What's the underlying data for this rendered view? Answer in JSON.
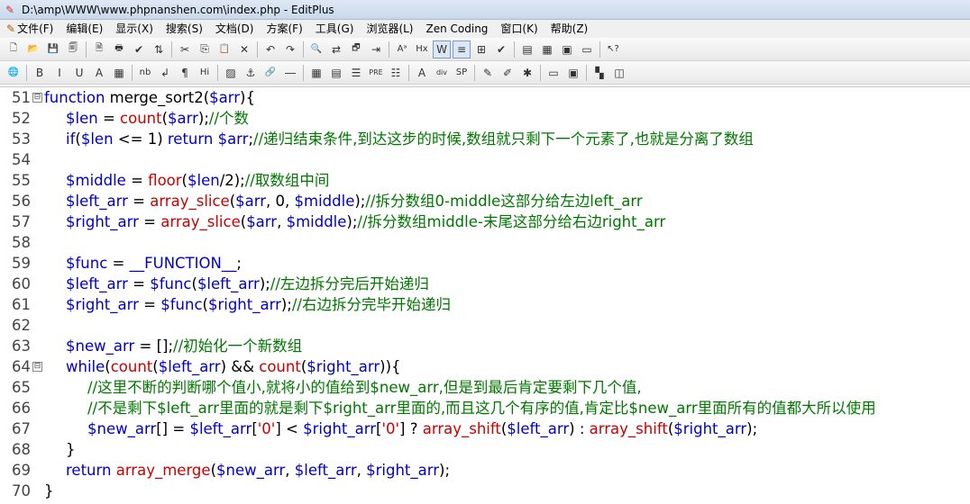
{
  "window": {
    "title": "D:\\amp\\WWW\\www.phpnanshen.com\\index.php - EditPlus"
  },
  "menu": [
    {
      "label": "文件(F)"
    },
    {
      "label": "编辑(E)"
    },
    {
      "label": "显示(X)"
    },
    {
      "label": "搜索(S)"
    },
    {
      "label": "文档(D)"
    },
    {
      "label": "方案(F)"
    },
    {
      "label": "工具(G)"
    },
    {
      "label": "浏览器(L)"
    },
    {
      "label": "Zen Coding"
    },
    {
      "label": "窗口(K)"
    },
    {
      "label": "帮助(Z)"
    }
  ],
  "toolbar1": [
    {
      "name": "new-file-icon",
      "glyph": "🗋"
    },
    {
      "name": "open-file-icon",
      "glyph": "📂"
    },
    {
      "name": "save-icon",
      "glyph": "💾"
    },
    {
      "name": "save-all-icon",
      "glyph": "🗐"
    },
    {
      "sep": true
    },
    {
      "name": "print-preview-icon",
      "glyph": "🗎"
    },
    {
      "name": "print-icon",
      "glyph": "🖶"
    },
    {
      "name": "spell-check-icon",
      "glyph": "✔"
    },
    {
      "name": "ftp-icon",
      "glyph": "⇅"
    },
    {
      "sep": true
    },
    {
      "name": "cut-icon",
      "glyph": "✂"
    },
    {
      "name": "copy-icon",
      "glyph": "⎘"
    },
    {
      "name": "paste-icon",
      "glyph": "📋"
    },
    {
      "name": "delete-icon",
      "glyph": "✕"
    },
    {
      "sep": true
    },
    {
      "name": "undo-icon",
      "glyph": "↶"
    },
    {
      "name": "redo-icon",
      "glyph": "↷"
    },
    {
      "sep": true
    },
    {
      "name": "find-icon",
      "glyph": "🔍"
    },
    {
      "name": "replace-icon",
      "glyph": "⇄"
    },
    {
      "name": "find-in-files-icon",
      "glyph": "🗗"
    },
    {
      "name": "goto-line-icon",
      "glyph": "⇥"
    },
    {
      "sep": true
    },
    {
      "name": "font-icon",
      "glyph": "Aᵃ"
    },
    {
      "name": "hex-icon",
      "glyph": "Hx"
    },
    {
      "name": "word-wrap-icon",
      "glyph": "W",
      "active": true
    },
    {
      "name": "line-number-icon",
      "glyph": "≡",
      "active": true
    },
    {
      "name": "column-icon",
      "glyph": "⊞"
    },
    {
      "name": "check-icon",
      "glyph": "✔"
    },
    {
      "sep": true
    },
    {
      "name": "window-list-icon",
      "glyph": "▤"
    },
    {
      "name": "cliptext-icon",
      "glyph": "▦"
    },
    {
      "name": "directory-icon",
      "glyph": "▣"
    },
    {
      "name": "output-icon",
      "glyph": "▭"
    },
    {
      "sep": true
    },
    {
      "name": "help-pointer-icon",
      "glyph": "↖?"
    }
  ],
  "toolbar2": [
    {
      "name": "browser-icon",
      "glyph": "🌐"
    },
    {
      "sep": true
    },
    {
      "name": "bold-icon",
      "glyph": "B"
    },
    {
      "name": "italic-icon",
      "glyph": "I"
    },
    {
      "name": "underline-icon",
      "glyph": "U"
    },
    {
      "name": "font-color-icon",
      "glyph": "A"
    },
    {
      "name": "color-grid-icon",
      "glyph": "▦"
    },
    {
      "sep": true
    },
    {
      "name": "nbsp-icon",
      "glyph": "nb"
    },
    {
      "name": "line-break-icon",
      "glyph": "↲"
    },
    {
      "name": "paragraph-icon",
      "glyph": "¶"
    },
    {
      "name": "heading-icon",
      "glyph": "Hi"
    },
    {
      "sep": true
    },
    {
      "name": "image-icon",
      "glyph": "▨"
    },
    {
      "name": "anchor-icon",
      "glyph": "⚓"
    },
    {
      "name": "link-icon",
      "glyph": "🔗"
    },
    {
      "name": "hr-icon",
      "glyph": "―"
    },
    {
      "sep": true
    },
    {
      "name": "table-icon",
      "glyph": "▦"
    },
    {
      "name": "form-icon",
      "glyph": "▤"
    },
    {
      "name": "center-icon",
      "glyph": "☰"
    },
    {
      "name": "pre-icon",
      "glyph": "PRE"
    },
    {
      "name": "list-icon",
      "glyph": "☷"
    },
    {
      "sep": true
    },
    {
      "name": "span-icon",
      "glyph": "A"
    },
    {
      "name": "div-icon",
      "glyph": "div"
    },
    {
      "name": "space-icon",
      "glyph": "SP"
    },
    {
      "sep": true
    },
    {
      "name": "edit-icon",
      "glyph": "✎"
    },
    {
      "name": "comment-icon",
      "glyph": "✐"
    },
    {
      "name": "tags-icon",
      "glyph": "✱"
    },
    {
      "sep": true
    },
    {
      "name": "frame-icon",
      "glyph": "▭"
    },
    {
      "name": "frame2-icon",
      "glyph": "▣"
    },
    {
      "sep": true
    },
    {
      "name": "palette-icon",
      "glyph": "▚"
    },
    {
      "name": "panel-icon",
      "glyph": "◫"
    }
  ],
  "lines": [
    {
      "n": "51",
      "fold": "⊟",
      "indent": 0,
      "tokens": [
        [
          "kw",
          "function "
        ],
        [
          "plain",
          "merge_sort2("
        ],
        [
          "var",
          "$arr"
        ],
        [
          "plain",
          "){"
        ]
      ]
    },
    {
      "n": "52",
      "indent": 1,
      "tokens": [
        [
          "var",
          "$len"
        ],
        [
          "op",
          " = "
        ],
        [
          "fn",
          "count"
        ],
        [
          "plain",
          "("
        ],
        [
          "var",
          "$arr"
        ],
        [
          "plain",
          ");"
        ],
        [
          "cm",
          "//个数"
        ]
      ]
    },
    {
      "n": "53",
      "indent": 1,
      "tokens": [
        [
          "kw",
          "if"
        ],
        [
          "plain",
          "("
        ],
        [
          "var",
          "$len"
        ],
        [
          "op",
          " <= "
        ],
        [
          "num",
          "1"
        ],
        [
          "plain",
          ") "
        ],
        [
          "kw",
          "return "
        ],
        [
          "var",
          "$arr"
        ],
        [
          "plain",
          ";"
        ],
        [
          "cm",
          "//递归结束条件,到达这步的时候,数组就只剩下一个元素了,也就是分离了数组"
        ]
      ]
    },
    {
      "n": "54",
      "indent": 0,
      "tokens": []
    },
    {
      "n": "55",
      "indent": 1,
      "tokens": [
        [
          "var",
          "$middle"
        ],
        [
          "op",
          " = "
        ],
        [
          "fn",
          "floor"
        ],
        [
          "plain",
          "("
        ],
        [
          "var",
          "$len"
        ],
        [
          "plain",
          "/2);"
        ],
        [
          "cm",
          "//取数组中间"
        ]
      ]
    },
    {
      "n": "56",
      "indent": 1,
      "tokens": [
        [
          "var",
          "$left_arr"
        ],
        [
          "op",
          " = "
        ],
        [
          "fn",
          "array_slice"
        ],
        [
          "plain",
          "("
        ],
        [
          "var",
          "$arr"
        ],
        [
          "plain",
          ", 0, "
        ],
        [
          "var",
          "$middle"
        ],
        [
          "plain",
          ");"
        ],
        [
          "cm",
          "//拆分数组0-middle这部分给左边left_arr"
        ]
      ]
    },
    {
      "n": "57",
      "indent": 1,
      "tokens": [
        [
          "var",
          "$right_arr"
        ],
        [
          "op",
          " = "
        ],
        [
          "fn",
          "array_slice"
        ],
        [
          "plain",
          "("
        ],
        [
          "var",
          "$arr"
        ],
        [
          "plain",
          ", "
        ],
        [
          "var",
          "$middle"
        ],
        [
          "plain",
          ");"
        ],
        [
          "cm",
          "//拆分数组middle-末尾这部分给右边right_arr"
        ]
      ]
    },
    {
      "n": "58",
      "indent": 0,
      "tokens": []
    },
    {
      "n": "59",
      "indent": 1,
      "tokens": [
        [
          "var",
          "$func"
        ],
        [
          "op",
          " = "
        ],
        [
          "kw",
          "__FUNCTION__"
        ],
        [
          "plain",
          ";"
        ]
      ]
    },
    {
      "n": "60",
      "indent": 1,
      "tokens": [
        [
          "var",
          "$left_arr"
        ],
        [
          "op",
          " = "
        ],
        [
          "var",
          "$func"
        ],
        [
          "plain",
          "("
        ],
        [
          "var",
          "$left_arr"
        ],
        [
          "plain",
          ");"
        ],
        [
          "cm",
          "//左边拆分完后开始递归"
        ]
      ]
    },
    {
      "n": "61",
      "indent": 1,
      "tokens": [
        [
          "var",
          "$right_arr"
        ],
        [
          "op",
          " = "
        ],
        [
          "var",
          "$func"
        ],
        [
          "plain",
          "("
        ],
        [
          "var",
          "$right_arr"
        ],
        [
          "plain",
          ");"
        ],
        [
          "cm",
          "//右边拆分完毕开始递归"
        ]
      ]
    },
    {
      "n": "62",
      "indent": 0,
      "tokens": []
    },
    {
      "n": "63",
      "indent": 1,
      "tokens": [
        [
          "var",
          "$new_arr"
        ],
        [
          "op",
          " = "
        ],
        [
          "plain",
          "[];"
        ],
        [
          "cm",
          "//初始化一个新数组"
        ]
      ]
    },
    {
      "n": "64",
      "fold": "⊟",
      "indent": 1,
      "tokens": [
        [
          "kw",
          "while"
        ],
        [
          "plain",
          "("
        ],
        [
          "fn",
          "count"
        ],
        [
          "plain",
          "("
        ],
        [
          "var",
          "$left_arr"
        ],
        [
          "plain",
          ") && "
        ],
        [
          "fn",
          "count"
        ],
        [
          "plain",
          "("
        ],
        [
          "var",
          "$right_arr"
        ],
        [
          "plain",
          "))"
        ],
        [
          "plain",
          "{"
        ]
      ]
    },
    {
      "n": "65",
      "indent": 2,
      "tokens": [
        [
          "cm",
          "//这里不断的判断哪个值小,就将小的值给到$new_arr,但是到最后肯定要剩下几个值,"
        ]
      ]
    },
    {
      "n": "66",
      "indent": 2,
      "tokens": [
        [
          "cm",
          "//不是剩下$left_arr里面的就是剩下$right_arr里面的,而且这几个有序的值,肯定比$new_arr里面所有的值都大所以使用"
        ]
      ]
    },
    {
      "n": "67",
      "indent": 2,
      "tokens": [
        [
          "var",
          "$new_arr"
        ],
        [
          "plain",
          "[] = "
        ],
        [
          "var",
          "$left_arr"
        ],
        [
          "plain",
          "["
        ],
        [
          "str",
          "'0'"
        ],
        [
          "plain",
          "] < "
        ],
        [
          "var",
          "$right_arr"
        ],
        [
          "plain",
          "["
        ],
        [
          "str",
          "'0'"
        ],
        [
          "plain",
          "] ? "
        ],
        [
          "fn",
          "array_shift"
        ],
        [
          "plain",
          "("
        ],
        [
          "var",
          "$left_arr"
        ],
        [
          "plain",
          ") : "
        ],
        [
          "fn",
          "array_shift"
        ],
        [
          "plain",
          "("
        ],
        [
          "var",
          "$right_arr"
        ],
        [
          "plain",
          ");"
        ]
      ]
    },
    {
      "n": "68",
      "indent": 1,
      "tokens": [
        [
          "plain",
          "}"
        ]
      ]
    },
    {
      "n": "69",
      "indent": 1,
      "tokens": [
        [
          "kw",
          "return "
        ],
        [
          "fn",
          "array_merge"
        ],
        [
          "plain",
          "("
        ],
        [
          "var",
          "$new_arr"
        ],
        [
          "plain",
          ", "
        ],
        [
          "var",
          "$left_arr"
        ],
        [
          "plain",
          ", "
        ],
        [
          "var",
          "$right_arr"
        ],
        [
          "plain",
          ");"
        ]
      ]
    },
    {
      "n": "70",
      "indent": 0,
      "tokens": [
        [
          "plain",
          "}"
        ]
      ]
    }
  ]
}
